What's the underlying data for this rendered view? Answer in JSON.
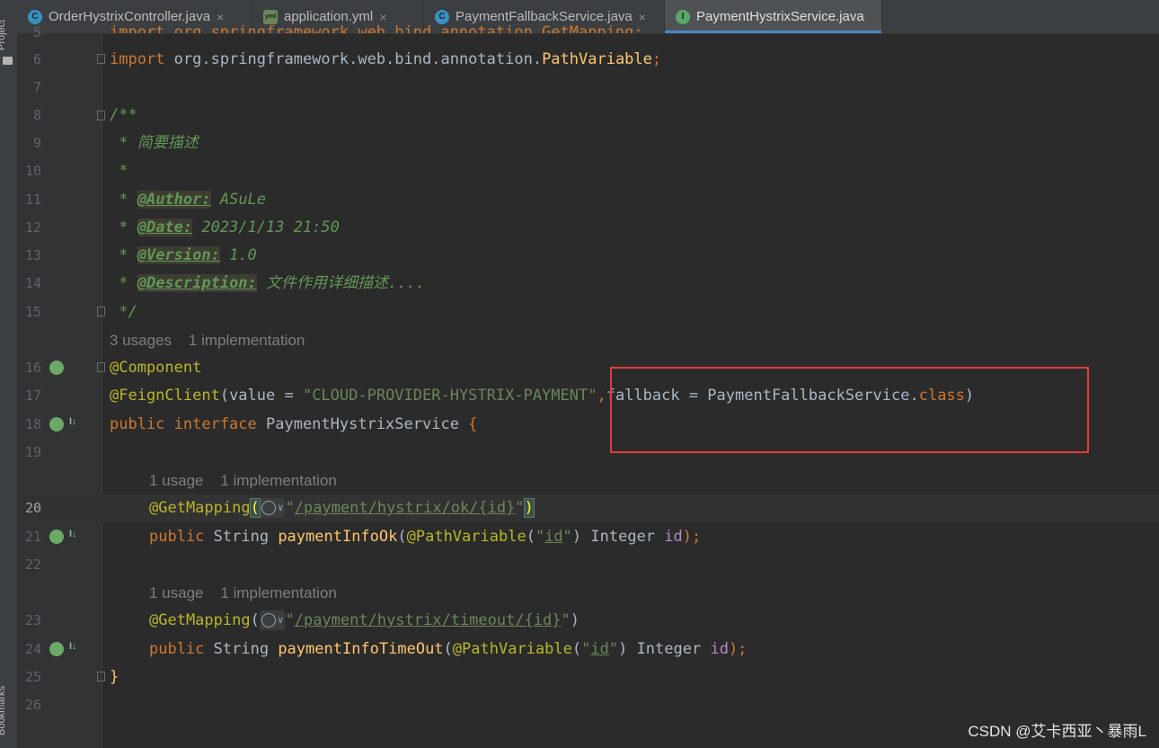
{
  "sidebar": {
    "project_label": "Project",
    "bookmarks_label": "Bookmarks"
  },
  "tabs": [
    {
      "label": "OrderHystrixController.java",
      "icon": "C"
    },
    {
      "label": "application.yml",
      "icon": "yml"
    },
    {
      "label": "PaymentFallbackService.java",
      "icon": "C"
    },
    {
      "label": "PaymentHystrixService.java",
      "icon": "I"
    }
  ],
  "close_glyph": "×",
  "line_numbers": [
    "5",
    "6",
    "7",
    "8",
    "9",
    "10",
    "11",
    "12",
    "13",
    "14",
    "15",
    "16",
    "17",
    "18",
    "19",
    "20",
    "21",
    "22",
    "23",
    "24",
    "25",
    "26"
  ],
  "code": {
    "l5": "import org.springframework.web.bind.annotation.GetMapping;",
    "l6_kw": "import",
    "l6_pkg": " org.springframework.web.bind.annotation.",
    "l6_cls": "PathVariable",
    "l6_semi": ";",
    "l8": "/**",
    "l9": " * 简要描述",
    "l10": " *",
    "l11_pre": " * ",
    "l11_tag": "@Author:",
    "l11_val": " ASuLe",
    "l12_pre": " * ",
    "l12_tag": "@Date:",
    "l12_val": " 2023/1/13 21:50",
    "l13_pre": " * ",
    "l13_tag": "@Version:",
    "l13_val": " 1.0",
    "l14_pre": " * ",
    "l14_tag": "@Description:",
    "l14_val": " 文件作用详细描述....",
    "l15": " */",
    "hint1": "3 usages    1 implementation",
    "l16": "@Component",
    "l17_ann": "@FeignClient",
    "l17_a": "(value = ",
    "l17_str": "\"CLOUD-PROVIDER-HYSTRIX-PAYMENT\"",
    "l17_comma": ",",
    "l17_b": "fallback = PaymentFallbackService.",
    "l17_class": "class",
    "l17_c": ")",
    "l18_kw1": "public interface",
    "l18_name": " PaymentHystrixService ",
    "l18_brace": "{",
    "hint2": "1 usage    1 implementation",
    "l20_ann": "@GetMapping",
    "l20_open": "(",
    "l20_q1": "\"",
    "l20_url": "/payment/hystrix/ok/{id}",
    "l20_q2": "\"",
    "l20_close": ")",
    "l21_kw": "public",
    "l21_type": " String ",
    "l21_method": "paymentInfoOk",
    "l21_a": "(",
    "l21_ann": "@PathVariable",
    "l21_b": "(",
    "l21_q1": "\"",
    "l21_id": "id",
    "l21_q2": "\"",
    "l21_c": ") Integer ",
    "l21_param": "id",
    "l21_d": ");",
    "hint3": "1 usage    1 implementation",
    "l23_ann": "@GetMapping",
    "l23_open": "(",
    "l23_q1": "\"",
    "l23_url": "/payment/hystrix/timeout/{id}",
    "l23_q2": "\"",
    "l23_close": ")",
    "l24_kw": "public",
    "l24_type": " String ",
    "l24_method": "paymentInfoTimeOut",
    "l24_a": "(",
    "l24_ann": "@PathVariable",
    "l24_b": "(",
    "l24_q1": "\"",
    "l24_id": "id",
    "l24_q2": "\"",
    "l24_c": ") Integer ",
    "l24_param": "id",
    "l24_d": ");",
    "l25": "}"
  },
  "watermark": "CSDN @艾卡西亚丶暴雨L",
  "colors": {
    "keyword": "#cc7832",
    "annotation": "#bbb529",
    "string": "#6a8759",
    "doc": "#629755",
    "highlight_box": "#e63a3a",
    "active_tab_underline": "#4a88c7"
  }
}
